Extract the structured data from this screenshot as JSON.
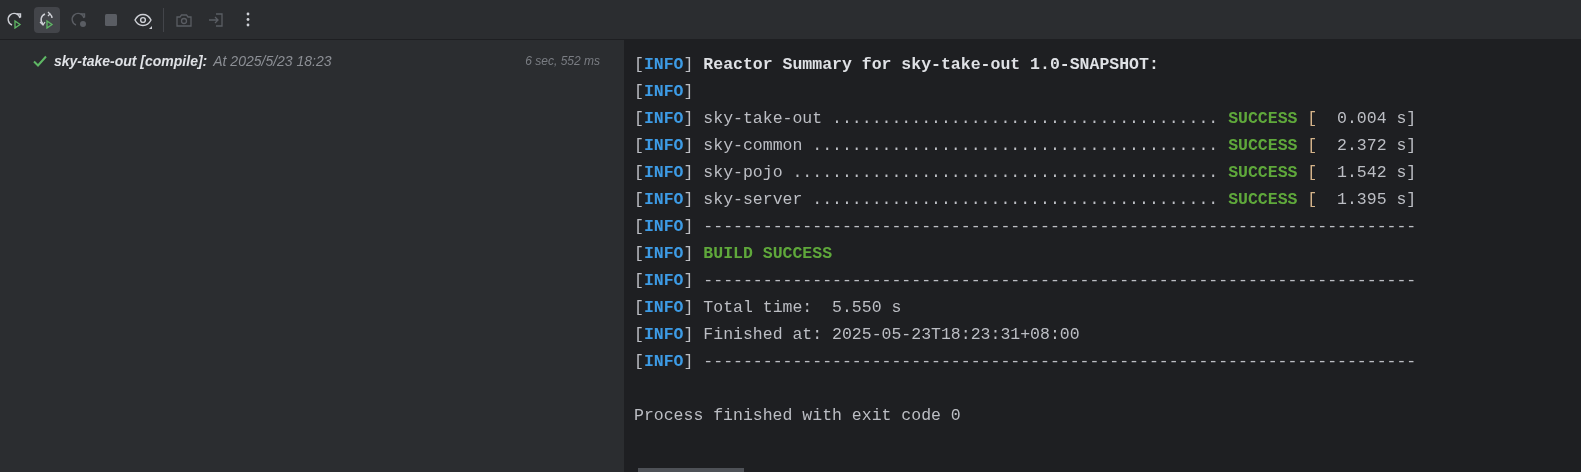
{
  "toolbar": [
    {
      "kind": "rerun",
      "disabled": false,
      "toggled": false
    },
    {
      "kind": "toggle-auto",
      "disabled": false,
      "toggled": true
    },
    {
      "kind": "rerun-failed",
      "disabled": true,
      "toggled": false
    },
    {
      "kind": "stop",
      "disabled": true,
      "toggled": false
    },
    {
      "kind": "view",
      "disabled": false,
      "toggled": false
    },
    {
      "kind": "separator"
    },
    {
      "kind": "screenshot",
      "disabled": true,
      "toggled": false
    },
    {
      "kind": "export",
      "disabled": true,
      "toggled": false
    },
    {
      "kind": "more",
      "disabled": false,
      "toggled": false
    }
  ],
  "build_tree": [
    {
      "succeeded": true,
      "name": "sky-take-out [compile]:",
      "time": "At 2025/5/23 18:23",
      "duration": "6 sec, 552 ms"
    }
  ],
  "console": {
    "lines": [
      {
        "kind": "bold",
        "open": "[",
        "level": "INFO",
        "close": "]",
        "text": "Reactor Summary for sky-take-out 1.0-SNAPSHOT:"
      },
      {
        "kind": "plain",
        "open": "[",
        "level": "INFO",
        "close": "]"
      },
      {
        "kind": "module",
        "open": "[",
        "level": "INFO",
        "close": "]",
        "text": "sky-take-out .......................................",
        "status": "SUCCESS",
        "bracket": "[",
        "time": "  0.004 s]"
      },
      {
        "kind": "module",
        "open": "[",
        "level": "INFO",
        "close": "]",
        "text": "sky-common .........................................",
        "status": "SUCCESS",
        "bracket": "[",
        "time": "  2.372 s]"
      },
      {
        "kind": "module",
        "open": "[",
        "level": "INFO",
        "close": "]",
        "text": "sky-pojo ...........................................",
        "status": "SUCCESS",
        "bracket": "[",
        "time": "  1.542 s]"
      },
      {
        "kind": "module",
        "open": "[",
        "level": "INFO",
        "close": "]",
        "text": "sky-server .........................................",
        "status": "SUCCESS",
        "bracket": "[",
        "time": "  1.395 s]"
      },
      {
        "kind": "plain",
        "open": "[",
        "level": "INFO",
        "close": "]",
        "text": "------------------------------------------------------------------------"
      },
      {
        "kind": "success",
        "open": "[",
        "level": "INFO",
        "close": "]",
        "text": "BUILD SUCCESS"
      },
      {
        "kind": "plain",
        "open": "[",
        "level": "INFO",
        "close": "]",
        "text": "------------------------------------------------------------------------"
      },
      {
        "kind": "plain",
        "open": "[",
        "level": "INFO",
        "close": "]",
        "text": "Total time:  5.550 s"
      },
      {
        "kind": "plain",
        "open": "[",
        "level": "INFO",
        "close": "]",
        "text": "Finished at: 2025-05-23T18:23:31+08:00"
      },
      {
        "kind": "plain",
        "open": "[",
        "level": "INFO",
        "close": "]",
        "text": "------------------------------------------------------------------------"
      },
      {
        "kind": "blank"
      },
      {
        "kind": "process",
        "text": "Process finished with exit code 0"
      }
    ]
  }
}
